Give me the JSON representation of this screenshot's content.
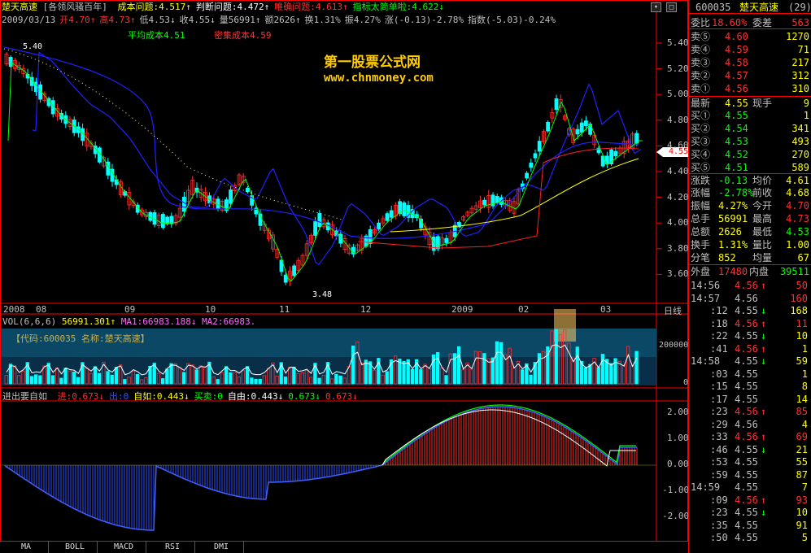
{
  "header": {
    "stock_name": "楚天高速",
    "formula": "[各领风骚百年]",
    "items": [
      {
        "text": "成本问题:4.517↑",
        "color": "#ffff00"
      },
      {
        "text": "判断问题:4.472↑",
        "color": "#ffffff"
      },
      {
        "text": "唯确问题:4.613↑",
        "color": "#ff3030"
      },
      {
        "text": "指标太简单啦:4.622↓",
        "color": "#00ff00"
      }
    ],
    "line2": [
      {
        "text": "2009/03/13",
        "color": "#c0c0c0"
      },
      {
        "text": "开4.70↑",
        "color": "#ff3030"
      },
      {
        "text": "高4.73↑",
        "color": "#ff3030"
      },
      {
        "text": "低4.53↓",
        "color": "#c0c0c0"
      },
      {
        "text": "收4.55↓",
        "color": "#c0c0c0"
      },
      {
        "text": "量56991↑",
        "color": "#c0c0c0"
      },
      {
        "text": "额2626↑",
        "color": "#c0c0c0"
      },
      {
        "text": "换1.31%",
        "color": "#c0c0c0"
      },
      {
        "text": "振4.27%",
        "color": "#c0c0c0"
      },
      {
        "text": "涨(-0.13)-2.78%",
        "color": "#c0c0c0"
      },
      {
        "text": "指数(-5.03)-0.24%",
        "color": "#c0c0c0"
      }
    ],
    "avg_cost": "平均成本4.51",
    "dense_cost": "密集成本4.59"
  },
  "watermark": {
    "title": "第一股票公式网",
    "url": "www.chnmoney.com"
  },
  "main_chart": {
    "price_labels": [
      "5.40",
      "5.20",
      "5.00",
      "4.80",
      "4.60",
      "4.40",
      "4.20",
      "4.00",
      "3.80",
      "3.60"
    ],
    "current_price": "4.55",
    "high_label": "5.40",
    "low_label": "3.48",
    "date_labels": [
      "2008",
      "08",
      "09",
      "10",
      "11",
      "12",
      "2009",
      "02",
      "03"
    ],
    "period": "日线"
  },
  "volume_chart": {
    "title": "VOL(6,6,6)",
    "vol": "56991.301↑",
    "ma1": "MA1:66983.188↓",
    "ma2": "MA2:66983.",
    "code_label": "【代码:600035 名称:楚天高速】",
    "axis_labels": [
      "200000",
      "0"
    ]
  },
  "indicator_chart": {
    "title": "进出要自如",
    "items": [
      {
        "text": "进:0.673↓",
        "color": "#ff3030"
      },
      {
        "text": "出:0",
        "color": "#3050ff"
      },
      {
        "text": "自如:0.443↓",
        "color": "#ffff00"
      },
      {
        "text": "买卖:0",
        "color": "#00ff00"
      },
      {
        "text": "自由:0.443↓",
        "color": "#ffffff"
      },
      {
        "text": "0.673↓",
        "color": "#00ff00"
      },
      {
        "text": "0.673↓",
        "color": "#ff3030"
      }
    ],
    "axis_labels": [
      "2.00",
      "1.00",
      "0.00",
      "-1.00",
      "-2.00"
    ]
  },
  "tabs": [
    "MA",
    "BOLL",
    "MACD",
    "RSI",
    "DMI"
  ],
  "right_panel": {
    "code": "600035",
    "name": "楚天高速",
    "count": "(29)",
    "weibi_label": "委比",
    "weibi_val": "18.60%",
    "weicha_label": "委差",
    "weicha_val": "563",
    "asks": [
      {
        "label": "卖⑤",
        "price": "4.60",
        "vol": "1270"
      },
      {
        "label": "卖④",
        "price": "4.59",
        "vol": "71"
      },
      {
        "label": "卖③",
        "price": "4.58",
        "vol": "217"
      },
      {
        "label": "卖②",
        "price": "4.57",
        "vol": "312"
      },
      {
        "label": "卖①",
        "price": "4.56",
        "vol": "310"
      }
    ],
    "latest": {
      "label": "最新",
      "price": "4.55",
      "label2": "现手",
      "vol": "9"
    },
    "bids": [
      {
        "label": "买①",
        "price": "4.55",
        "vol": "1"
      },
      {
        "label": "买②",
        "price": "4.54",
        "vol": "341"
      },
      {
        "label": "买③",
        "price": "4.53",
        "vol": "493"
      },
      {
        "label": "买④",
        "price": "4.52",
        "vol": "270"
      },
      {
        "label": "买⑤",
        "price": "4.51",
        "vol": "589"
      }
    ],
    "stats": [
      {
        "l1": "涨跌",
        "v1": "-0.13",
        "c1": "#00ff00",
        "l2": "均价",
        "v2": "4.61",
        "c2": "#ffff00"
      },
      {
        "l1": "涨幅",
        "v1": "-2.78%",
        "c1": "#00ff00",
        "l2": "前收",
        "v2": "4.68",
        "c2": "#ffff00"
      },
      {
        "l1": "振幅",
        "v1": "4.27%",
        "c1": "#ffff00",
        "l2": "今开",
        "v2": "4.70",
        "c2": "#ff3030"
      },
      {
        "l1": "总手",
        "v1": "56991",
        "c1": "#ffff00",
        "l2": "最高",
        "v2": "4.73",
        "c2": "#ff3030"
      },
      {
        "l1": "总额",
        "v1": "2626",
        "c1": "#ffff00",
        "l2": "最低",
        "v2": "4.53",
        "c2": "#00ff00"
      },
      {
        "l1": "换手",
        "v1": "1.31%",
        "c1": "#ffff00",
        "l2": "量比",
        "v2": "1.00",
        "c2": "#ffff00"
      },
      {
        "l1": "分笔",
        "v1": "852",
        "c1": "#ffff00",
        "l2": "均量",
        "v2": "67",
        "c2": "#ffff00"
      }
    ],
    "outer_label": "外盘",
    "outer_val": "17480",
    "inner_label": "内盘",
    "inner_val": "39511",
    "ticks": [
      {
        "t": "14:56",
        "p": "4.56",
        "d": "↑",
        "v": "50",
        "vc": "#ff3030"
      },
      {
        "t": "14:57",
        "p": "4.56",
        "d": "",
        "v": "160",
        "vc": "#ff3030"
      },
      {
        "t": ":12",
        "p": "4.55",
        "d": "↓",
        "v": "168",
        "vc": "#ffff00"
      },
      {
        "t": ":18",
        "p": "4.56",
        "d": "↑",
        "v": "11",
        "vc": "#ff3030"
      },
      {
        "t": ":22",
        "p": "4.55",
        "d": "↓",
        "v": "10",
        "vc": "#ffff00"
      },
      {
        "t": ":41",
        "p": "4.56",
        "d": "↑",
        "v": "1",
        "vc": "#ffff00"
      },
      {
        "t": "14:58",
        "p": "4.55",
        "d": "↓",
        "v": "59",
        "vc": "#ffff00"
      },
      {
        "t": ":03",
        "p": "4.55",
        "d": "",
        "v": "1",
        "vc": "#ffff00"
      },
      {
        "t": ":15",
        "p": "4.55",
        "d": "",
        "v": "8",
        "vc": "#ffff00"
      },
      {
        "t": ":17",
        "p": "4.55",
        "d": "",
        "v": "14",
        "vc": "#ffff00"
      },
      {
        "t": ":23",
        "p": "4.56",
        "d": "↑",
        "v": "85",
        "vc": "#ff3030"
      },
      {
        "t": ":29",
        "p": "4.56",
        "d": "",
        "v": "4",
        "vc": "#ffff00"
      },
      {
        "t": ":33",
        "p": "4.56",
        "d": "↑",
        "v": "69",
        "vc": "#ff3030"
      },
      {
        "t": ":46",
        "p": "4.55",
        "d": "↓",
        "v": "21",
        "vc": "#ffff00"
      },
      {
        "t": ":53",
        "p": "4.55",
        "d": "",
        "v": "55",
        "vc": "#ffff00"
      },
      {
        "t": ":59",
        "p": "4.55",
        "d": "",
        "v": "87",
        "vc": "#ffff00"
      },
      {
        "t": "14:59",
        "p": "4.55",
        "d": "",
        "v": "7",
        "vc": "#ffff00"
      },
      {
        "t": ":09",
        "p": "4.56",
        "d": "↑",
        "v": "93",
        "vc": "#ff3030"
      },
      {
        "t": ":23",
        "p": "4.55",
        "d": "↓",
        "v": "10",
        "vc": "#ffff00"
      },
      {
        "t": ":35",
        "p": "4.55",
        "d": "",
        "v": "91",
        "vc": "#ffff00"
      },
      {
        "t": ":50",
        "p": "4.55",
        "d": "",
        "v": "5",
        "vc": "#ffff00"
      }
    ]
  },
  "colors": {
    "up": "#ff3030",
    "down": "#00ffff",
    "axis": "#ff0000",
    "ma_blue": "#0000ff"
  }
}
